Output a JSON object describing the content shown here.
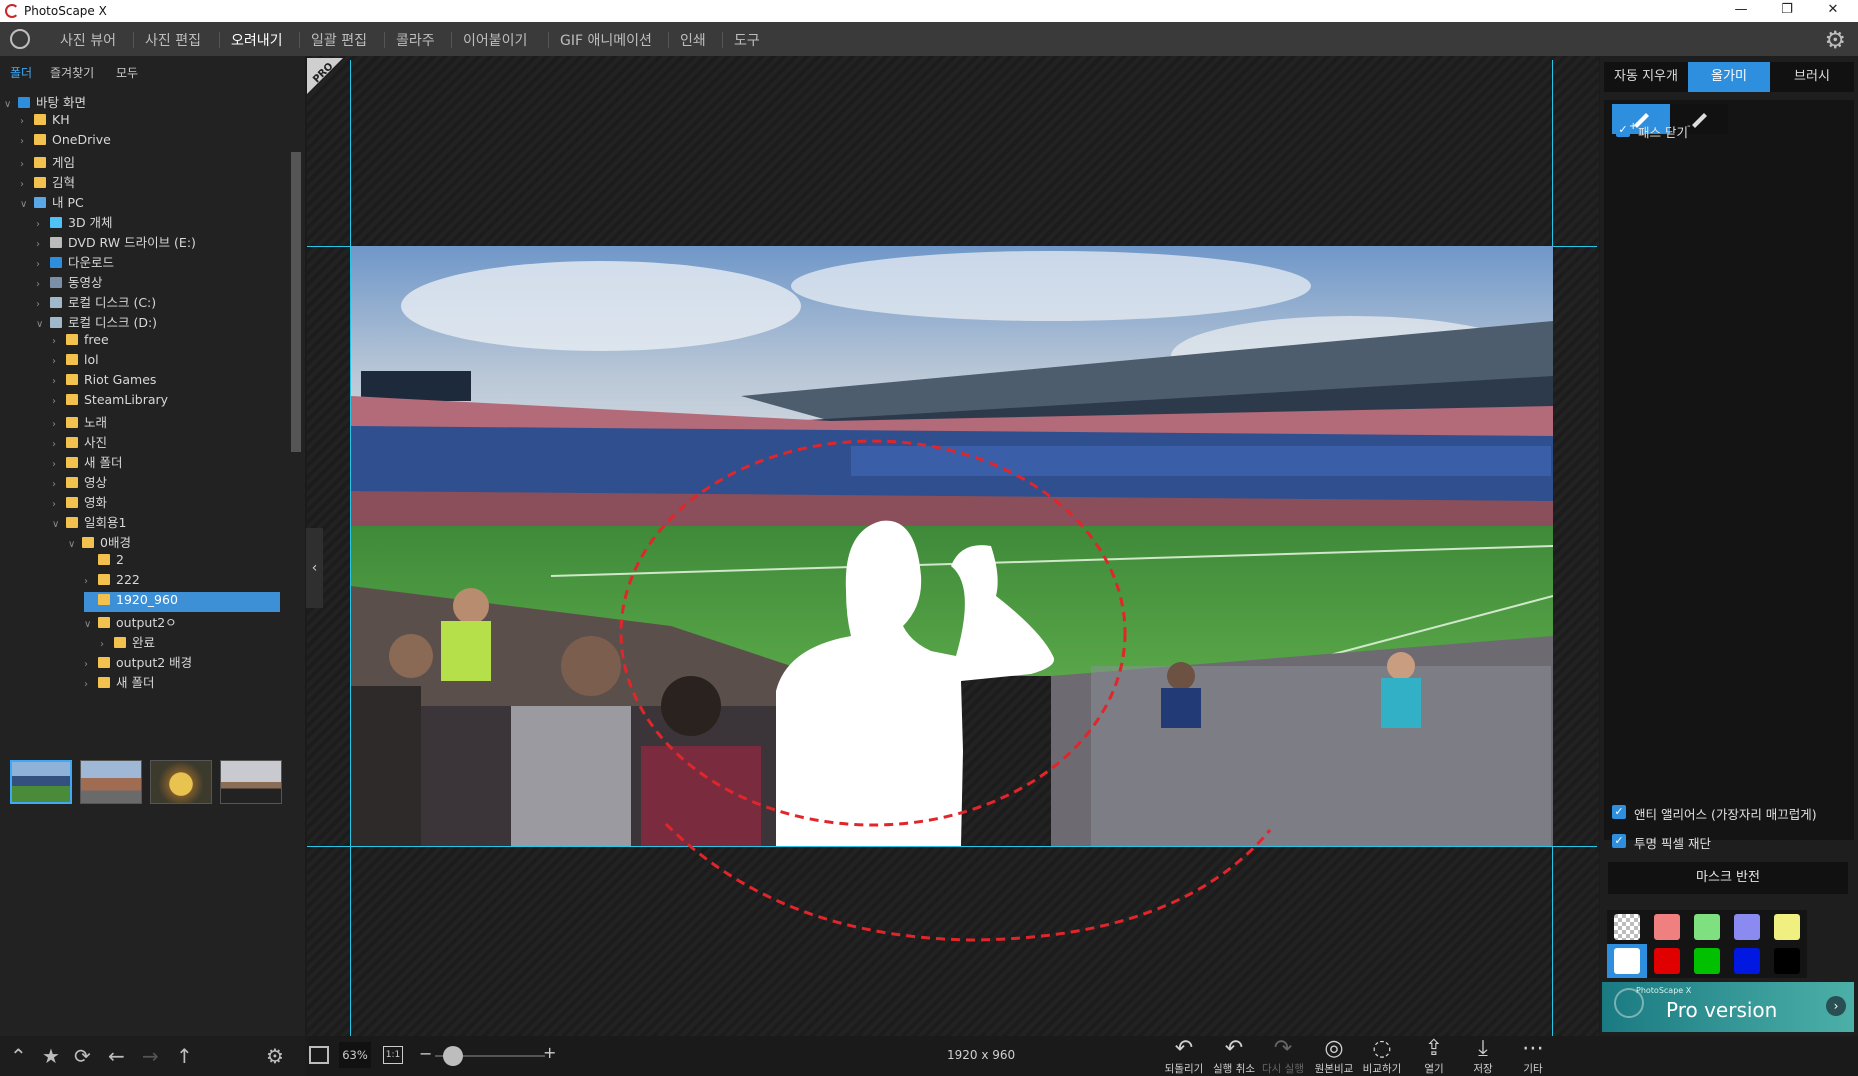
{
  "app": {
    "title": "PhotoScape X"
  },
  "window_controls": {
    "minimize": "—",
    "restore": "❐",
    "close": "✕"
  },
  "menu": {
    "items": [
      "사진 뷰어",
      "사진 편집",
      "오려내기",
      "일괄 편집",
      "콜라주",
      "이어붙이기",
      "GIF 애니메이션",
      "인쇄",
      "도구"
    ],
    "active_index": 2
  },
  "left_tabs": [
    "폴더",
    "즐겨찾기",
    "모두"
  ],
  "tree": [
    {
      "label": "바탕 화면",
      "indent": 0,
      "caret": "∨",
      "icon": "desktop"
    },
    {
      "label": "KH",
      "indent": 1,
      "caret": "›",
      "icon": "folder"
    },
    {
      "label": "OneDrive",
      "indent": 1,
      "caret": "›",
      "icon": "folder"
    },
    {
      "label": "게임",
      "indent": 1,
      "caret": "›",
      "icon": "folder"
    },
    {
      "label": "김혁",
      "indent": 1,
      "caret": "›",
      "icon": "folder"
    },
    {
      "label": "내 PC",
      "indent": 1,
      "caret": "∨",
      "icon": "pc"
    },
    {
      "label": "3D 개체",
      "indent": 2,
      "caret": "›",
      "icon": "3d"
    },
    {
      "label": "DVD RW 드라이브 (E:)",
      "indent": 2,
      "caret": "›",
      "icon": "dvd"
    },
    {
      "label": "다운로드",
      "indent": 2,
      "caret": "›",
      "icon": "download"
    },
    {
      "label": "동영상",
      "indent": 2,
      "caret": "›",
      "icon": "video"
    },
    {
      "label": "로컬 디스크 (C:)",
      "indent": 2,
      "caret": "›",
      "icon": "disk"
    },
    {
      "label": "로컬 디스크 (D:)",
      "indent": 2,
      "caret": "∨",
      "icon": "disk"
    },
    {
      "label": "free",
      "indent": 3,
      "caret": "›",
      "icon": "folder"
    },
    {
      "label": "lol",
      "indent": 3,
      "caret": "›",
      "icon": "folder"
    },
    {
      "label": "Riot Games",
      "indent": 3,
      "caret": "›",
      "icon": "folder"
    },
    {
      "label": "SteamLibrary",
      "indent": 3,
      "caret": "›",
      "icon": "folder"
    },
    {
      "label": "노래",
      "indent": 3,
      "caret": "›",
      "icon": "folder"
    },
    {
      "label": "사진",
      "indent": 3,
      "caret": "›",
      "icon": "folder"
    },
    {
      "label": "새 폴더",
      "indent": 3,
      "caret": "›",
      "icon": "folder"
    },
    {
      "label": "영상",
      "indent": 3,
      "caret": "›",
      "icon": "folder"
    },
    {
      "label": "영화",
      "indent": 3,
      "caret": "›",
      "icon": "folder"
    },
    {
      "label": "일회용1",
      "indent": 3,
      "caret": "∨",
      "icon": "folder"
    },
    {
      "label": "0배경",
      "indent": 4,
      "caret": "∨",
      "icon": "folder"
    },
    {
      "label": "2",
      "indent": 5,
      "caret": "",
      "icon": "folder"
    },
    {
      "label": "222",
      "indent": 5,
      "caret": "›",
      "icon": "folder"
    },
    {
      "label": "1920_960",
      "indent": 5,
      "caret": "",
      "icon": "folder",
      "selected": true
    },
    {
      "label": "output2ㅇ",
      "indent": 5,
      "caret": "∨",
      "icon": "folder"
    },
    {
      "label": "완료",
      "indent": 6,
      "caret": "›",
      "icon": "folder"
    },
    {
      "label": "output2 배경",
      "indent": 5,
      "caret": "›",
      "icon": "folder"
    },
    {
      "label": "새 폴더",
      "indent": 5,
      "caret": "›",
      "icon": "folder"
    }
  ],
  "left_bottom_icons": [
    "chevron-up",
    "star",
    "sync",
    "back-arrow",
    "forward-arrow",
    "up-arrow",
    "gear"
  ],
  "pro_badge": "PRO",
  "right_panel": {
    "tabs": [
      "자동 지우개",
      "올가미",
      "브러시"
    ],
    "active_tab": 1,
    "close_path_label": "패스 닫기",
    "antialias_label": "앤티 앨리어스 (가장자리 매끄럽게)",
    "trim_label": "투명 픽셀 재단",
    "mask_invert_label": "마스크 반전",
    "swatch_colors_light": [
      "checker",
      "#f08080",
      "#7fe07f",
      "#8a8af0",
      "#f0f080"
    ],
    "swatch_colors_dark": [
      "#ffffff",
      "#e00000",
      "#00c000",
      "#0018e0",
      "#000000"
    ],
    "promo": {
      "small": "PhotoScape X",
      "big": "Pro version"
    }
  },
  "bottom": {
    "zoom": "63%",
    "one_to_one": "1:1",
    "dimensions": "1920 x 960",
    "actions": [
      {
        "label": "되돌리기",
        "icon": "↶",
        "disabled": false
      },
      {
        "label": "실행 취소",
        "icon": "↶",
        "disabled": false
      },
      {
        "label": "다시 실행",
        "icon": "↷",
        "disabled": true
      },
      {
        "label": "원본비교",
        "icon": "◎",
        "disabled": false
      },
      {
        "label": "비교하기",
        "icon": "◌",
        "disabled": false
      },
      {
        "label": "열기",
        "icon": "⇪",
        "disabled": false
      },
      {
        "label": "저장",
        "icon": "⤓",
        "disabled": false
      },
      {
        "label": "기타",
        "icon": "⋯",
        "disabled": false
      }
    ]
  },
  "colors": {
    "accent": "#2e8fde",
    "guide": "#28c6e6",
    "lasso": "#e0262b",
    "folder": "#f2c14e"
  }
}
